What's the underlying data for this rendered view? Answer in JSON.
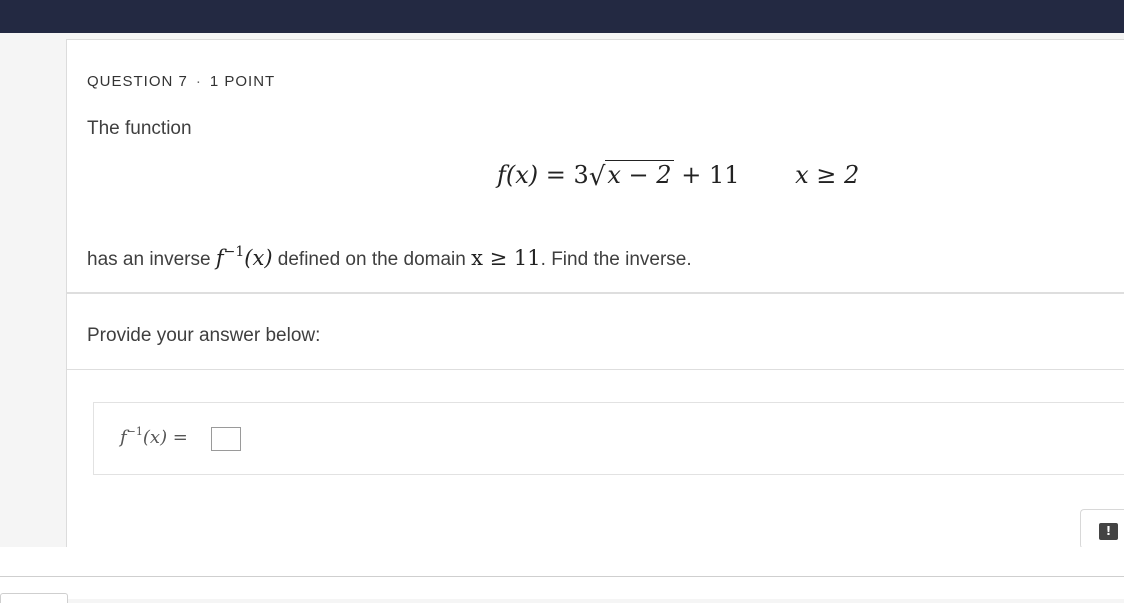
{
  "question": {
    "number_label": "QUESTION 7",
    "separator": "·",
    "points_label": "1 POINT",
    "intro": "The function",
    "function_lhs": "f(x)",
    "function_eq": "= 3",
    "radicand": "x − 2",
    "function_tail": "+ 11",
    "condition": "x ≥ 2",
    "prompt_part1": "has an inverse",
    "inverse_f": "f",
    "inverse_sup": "−1",
    "inverse_arg": "(x)",
    "prompt_part2": "defined on the domain",
    "domain_expr": "x ≥ 11",
    "prompt_part3": ". Find the inverse."
  },
  "answer": {
    "instruction": "Provide your answer below:",
    "label_f": "f",
    "label_sup": "−1",
    "label_rest": "(x) =",
    "input_value": ""
  },
  "feedback": {
    "icon": "report-issue-icon",
    "glyph": "!"
  }
}
